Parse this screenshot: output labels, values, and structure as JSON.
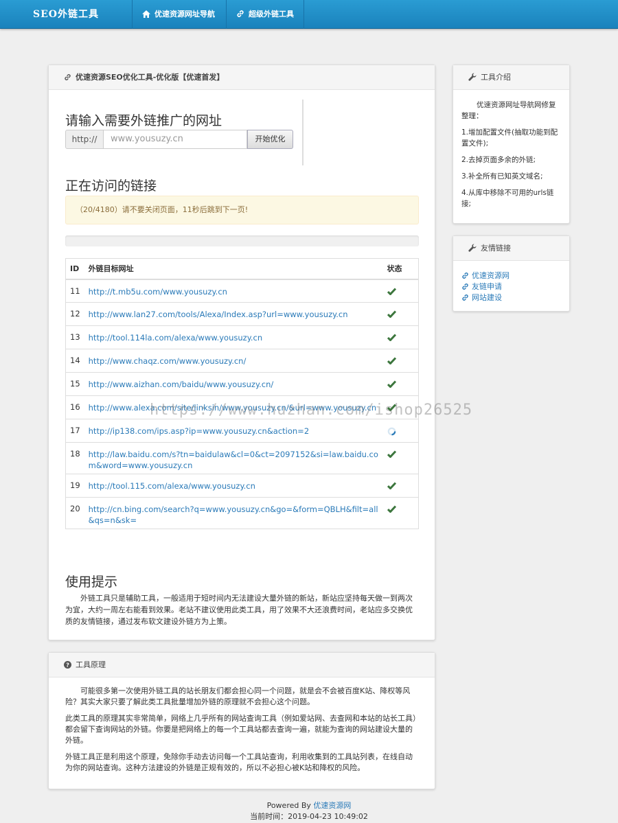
{
  "nav": {
    "brand": "SEO外链工具",
    "items": [
      {
        "label": "优速资源网址导航",
        "icon": "home-icon"
      },
      {
        "label": "超级外链工具",
        "icon": "link-icon"
      }
    ]
  },
  "main_panel": {
    "title": "优速资源SEO优化工具-优化版【优速首发】",
    "input_heading": "请输入需要外链推广的网址",
    "prefix": "http://",
    "url_placeholder": "www.yousuzy.cn",
    "submit_label": "开始优化",
    "visiting_heading": "正在访问的链接",
    "alert_text": "（20/4180）请不要关闭页面，11秒后跳到下一页!",
    "progress": 0,
    "table": {
      "headers": [
        "ID",
        "外链目标网址",
        "状态"
      ],
      "rows": [
        {
          "id": "11",
          "url": "http://t.mb5u.com/www.yousuzy.cn",
          "status": "ok"
        },
        {
          "id": "12",
          "url": "http://www.lan27.com/tools/Alexa/Index.asp?url=www.yousuzy.cn",
          "status": "ok"
        },
        {
          "id": "13",
          "url": "http://tool.114la.com/alexa/www.yousuzy.cn",
          "status": "ok"
        },
        {
          "id": "14",
          "url": "http://www.chaqz.com/www.yousuzy.cn/",
          "status": "ok"
        },
        {
          "id": "15",
          "url": "http://www.aizhan.com/baidu/www.yousuzy.cn/",
          "status": "ok"
        },
        {
          "id": "16",
          "url": "http://www.alexa.com/site/linksin/www.yousuzy.cn/&url=www.yousuzy.cn",
          "status": "ok"
        },
        {
          "id": "17",
          "url": "http://ip138.com/ips.asp?ip=www.yousuzy.cn&action=2",
          "status": "loading"
        },
        {
          "id": "18",
          "url": "http://law.baidu.com/s?tn=baidulaw&cl=0&ct=2097152&si=law.baidu.com&word=www.yousuzy.cn",
          "status": "ok"
        },
        {
          "id": "19",
          "url": "http://tool.115.com/alexa/www.yousuzy.cn",
          "status": "ok"
        },
        {
          "id": "20",
          "url": "http://cn.bing.com/search?q=www.yousuzy.cn&go=&form=QBLH&filt=all&qs=n&sk=",
          "status": "ok"
        }
      ]
    },
    "tips_heading": "使用提示",
    "tips_text": "外链工具只是辅助工具，一般适用于短时间内无法建设大量外链的新站，新站应坚持每天做一到两次为宜，大约一周左右能看到效果。老站不建议使用此类工具，用了效果不大还浪费时间，老站应多交换优质的友情链接，通过发布软文建设外链方为上策。"
  },
  "principle_panel": {
    "title": "工具原理",
    "paragraphs": [
      "可能很多第一次使用外链工具的站长朋友们都会担心同一个问题，就是会不会被百度K站、降权等风险？其实大家只要了解此类工具批量增加外链的原理就不会担心这个问题。",
      "此类工具的原理其实非常简单，网络上几乎所有的网站查询工具（例如爱站网、去查网和本站的站长工具）都会留下查询网站的外链。你要是把网络上的每一个工具站都去查询一遍，就能为查询的网站建设大量的外链。",
      "外链工具正是利用这个原理，免除你手动去访问每一个工具站查询，利用收集到的工具站列表，在线自动为你的网站查询。这种方法建设的外链是正规有效的，所以不必担心被K站和降权的风险。"
    ]
  },
  "intro_panel": {
    "title": "工具介绍",
    "items": [
      "优速资源网址导航网修复整理：",
      "1.增加配置文件(抽取功能到配置文件);",
      "2.去掉页面多余的外链;",
      "3.补全所有已知英文域名;",
      "4.从库中移除不可用的urls链接;"
    ]
  },
  "friends_panel": {
    "title": "友情链接",
    "links": [
      "优速资源网",
      "友链申请",
      "网站建设"
    ]
  },
  "footer": {
    "powered_prefix": "Powered By ",
    "powered_link": "优速资源网",
    "time": "当前时间：2019-04-23 10:49:02"
  },
  "watermark": "https://www.huzhan.com/ishop26525",
  "colors": {
    "nav": "#2a9cd3",
    "link": "#2a7ab8",
    "check": "#3c763d",
    "alert_bg": "#fcf8e3"
  }
}
